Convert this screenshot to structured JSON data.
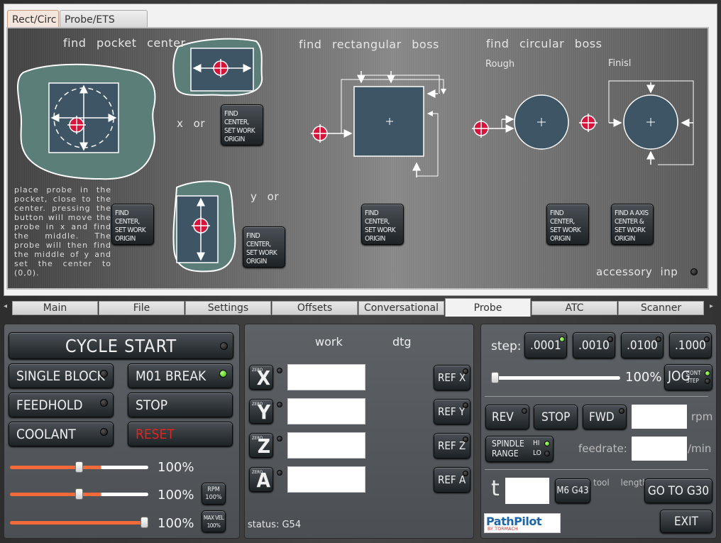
{
  "probe_tabs": [
    {
      "label": "Rect/Circ",
      "active": true
    },
    {
      "label": "Probe/ETS Setup",
      "active": false
    }
  ],
  "probe": {
    "pocket_title": "find pocket center",
    "rect_boss_title": "find rectangular boss",
    "circ_boss_title": "find circular boss",
    "rough_label": "Rough",
    "finish_label": "Finisl",
    "x_or": "x or",
    "y_or": "y or",
    "accessory_label": "accessory inp",
    "instructions": "place probe in the pocket, close to the center. pressing the button will move the probe in x and find the middle. The probe will then find the middle of y and set the center to (0,0).",
    "find_center_label": "FIND CENTER, SET WORK ORIGIN",
    "find_a_axis_label": "FIND A AXIS CENTER & SET WORK ORIGIN"
  },
  "main_tabs": [
    {
      "label": "Main",
      "active": false
    },
    {
      "label": "File",
      "active": false
    },
    {
      "label": "Settings",
      "active": false
    },
    {
      "label": "Offsets",
      "active": false
    },
    {
      "label": "Conversational",
      "active": false
    },
    {
      "label": "Probe",
      "active": true
    },
    {
      "label": "ATC",
      "active": false
    },
    {
      "label": "Scanner",
      "active": false
    }
  ],
  "left_panel": {
    "cycle_start": "CYCLE START",
    "single_block": "SINGLE BLOCK",
    "m01_break": "M01 BREAK",
    "feedhold": "FEEDHOLD",
    "stop": "STOP",
    "coolant": "COOLANT",
    "reset": "RESET",
    "m01_led_on": true,
    "feed_override": {
      "value": 0.5,
      "text": "100%"
    },
    "rpm_override": {
      "value": 0.5,
      "text": "100%"
    },
    "maxvel_override": {
      "value": 1.0,
      "text": "100%"
    },
    "rpm_button": "RPM",
    "rpm_button_value": "100%",
    "maxvel_button": "MAX VEL",
    "maxvel_button_value": "100%"
  },
  "dro": {
    "col_work": "work",
    "col_dtg": "dtg",
    "zero_label": "ZERO",
    "axes": [
      {
        "axis": "X",
        "value": "",
        "ref": "REF X"
      },
      {
        "axis": "Y",
        "value": "",
        "ref": "REF Y"
      },
      {
        "axis": "Z",
        "value": "",
        "ref": "REF Z"
      },
      {
        "axis": "A",
        "value": "",
        "ref": "REF A"
      }
    ],
    "status_label": "status:",
    "status_value": "G54"
  },
  "right_panel": {
    "step_label": "step:",
    "steps": [
      {
        "label": ".0001",
        "on": true
      },
      {
        "label": ".0010",
        "on": false
      },
      {
        "label": ".0100",
        "on": false
      },
      {
        "label": ".1000",
        "on": false
      }
    ],
    "jog_override": {
      "value": 0.0,
      "text": "100%"
    },
    "jog_button": "JOG",
    "jog_cont": "CONT",
    "jog_step": "STEP",
    "rev": "REV",
    "stop": "STOP",
    "fwd": "FWD",
    "rpm_unit": "rpm",
    "rpm_value": "",
    "spindle_range": "SPINDLE RANGE",
    "hi": "HI",
    "lo": "LO",
    "feedrate_label": "feedrate:",
    "feedrate_value": "",
    "feed_unit": "/min",
    "tool_label": "t",
    "tool_value": "",
    "m6g43": "M6 G43",
    "tool_length_label": "tool length",
    "goto_g30": "GO TO G30",
    "exit": "EXIT",
    "logo_text": "PathPilot",
    "logo_sub": "BY TORMACH"
  },
  "colors": {
    "accent_led": "#3fd41a",
    "reset_red": "#e0241f",
    "probe_target": "#d6143c",
    "shape_fill": "#3e5566",
    "pocket_fill": "#5b7f78"
  }
}
